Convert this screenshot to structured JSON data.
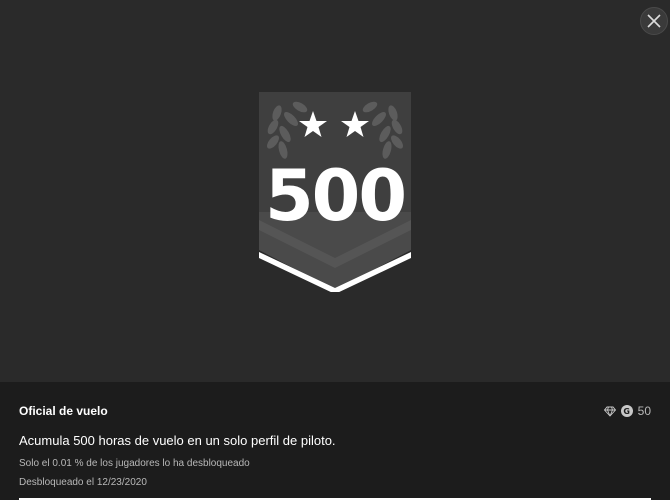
{
  "achievement": {
    "badge_number": "500",
    "title": "Oficial de vuelo",
    "description": "Acumula 500 horas de vuelo en un solo perfil de piloto.",
    "rarity_text": "Solo el 0.01 % de los jugadores lo ha desbloqueado",
    "unlocked_text": "Desbloqueado el 12/23/2020",
    "gamerscore": "50",
    "gamerscore_glyph": "G"
  },
  "icons": {
    "close": "close-icon",
    "rarity": "diamond-icon",
    "gamerscore": "gamerscore-icon"
  },
  "colors": {
    "hero_background": "#2a2a2a",
    "info_background": "#1c1c1c",
    "badge_shield": "#3f3f3f",
    "badge_laurel": "#5c5c5c",
    "muted_text": "#b8b8b8"
  }
}
